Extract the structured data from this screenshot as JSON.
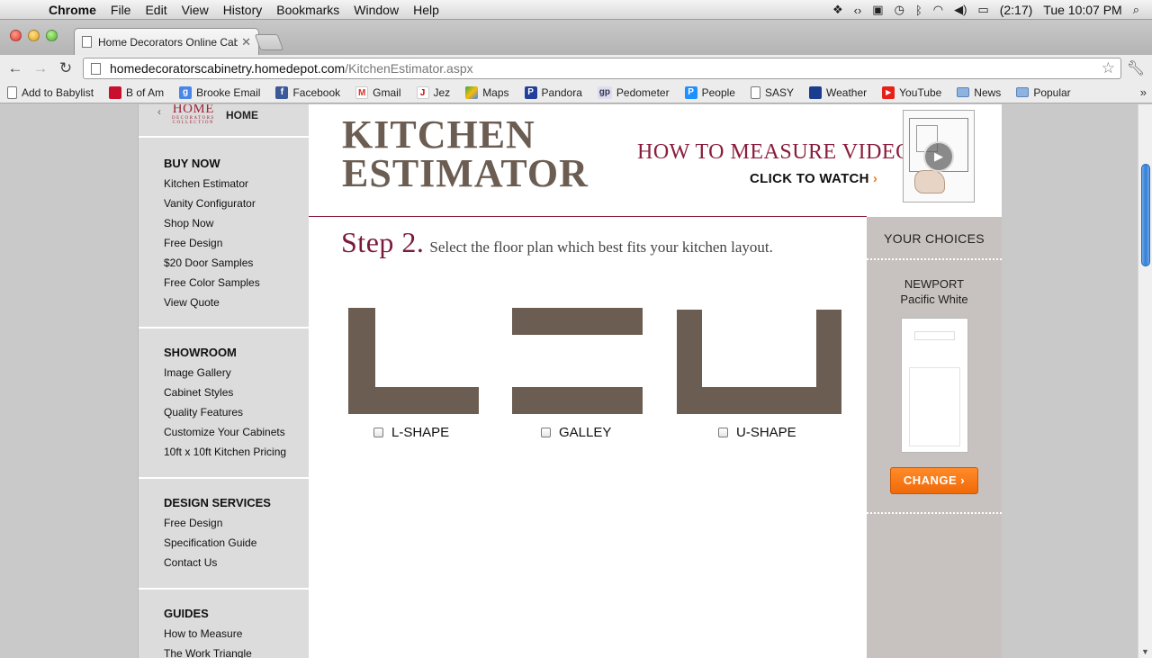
{
  "menubar": {
    "app": "Chrome",
    "menus": [
      "File",
      "Edit",
      "View",
      "History",
      "Bookmarks",
      "Window",
      "Help"
    ],
    "battery": "(2:17)",
    "clock": "Tue 10:07 PM"
  },
  "tab": {
    "title": "Home Decorators Online Cab"
  },
  "address": {
    "host": "homedecoratorscabinetry.homedepot.com",
    "path": "/KitchenEstimator.aspx"
  },
  "bookmarks": [
    {
      "label": "Add to Babylist",
      "icon": "doc"
    },
    {
      "label": "B of Am",
      "icon": "bofa"
    },
    {
      "label": "Brooke Email",
      "icon": "google"
    },
    {
      "label": "Facebook",
      "icon": "facebook"
    },
    {
      "label": "Gmail",
      "icon": "gmail"
    },
    {
      "label": "Jez",
      "icon": "jez"
    },
    {
      "label": "Maps",
      "icon": "maps"
    },
    {
      "label": "Pandora",
      "icon": "pandora"
    },
    {
      "label": "Pedometer",
      "icon": "gp"
    },
    {
      "label": "People",
      "icon": "people"
    },
    {
      "label": "SASY",
      "icon": "doc"
    },
    {
      "label": "Weather",
      "icon": "weather"
    },
    {
      "label": "YouTube",
      "icon": "youtube"
    },
    {
      "label": "News",
      "icon": "folder"
    },
    {
      "label": "Popular",
      "icon": "folder"
    }
  ],
  "brand": {
    "logo_line1": "HOME",
    "logo_line2": "DECORATORS",
    "logo_line3": "COLLECTION",
    "home": "HOME"
  },
  "nav": {
    "buy_now": {
      "title": "BUY NOW",
      "items": [
        "Kitchen Estimator",
        "Vanity Configurator",
        "Shop Now",
        "Free Design",
        "$20 Door Samples",
        "Free Color Samples",
        "View Quote"
      ]
    },
    "showroom": {
      "title": "SHOWROOM",
      "items": [
        "Image Gallery",
        "Cabinet Styles",
        "Quality Features",
        "Customize Your Cabinets",
        "10ft x 10ft Kitchen Pricing"
      ]
    },
    "design": {
      "title": "DESIGN SERVICES",
      "items": [
        "Free Design",
        "Specification Guide",
        "Contact Us"
      ]
    },
    "guides": {
      "title": "GUIDES",
      "items": [
        "How to Measure",
        "The Work Triangle"
      ]
    }
  },
  "header": {
    "title_line1": "KITCHEN",
    "title_line2": "ESTIMATOR",
    "video_title": "HOW TO MEASURE VIDEO",
    "video_cta": "CLICK TO WATCH",
    "video_cta_arrow": "›"
  },
  "step": {
    "number": "Step 2.",
    "instruction": "Select the floor plan which best fits your kitchen layout."
  },
  "plans": [
    {
      "label": "L-SHAPE",
      "checked": false
    },
    {
      "label": "GALLEY",
      "checked": false
    },
    {
      "label": "U-SHAPE",
      "checked": false
    }
  ],
  "choices": {
    "heading": "YOUR CHOICES",
    "door_style": "NEWPORT",
    "door_color": "Pacific White",
    "change_label": "CHANGE ›"
  },
  "colors": {
    "plan_fill": "#6b5d52",
    "accent_burgundy": "#8b1d3c",
    "change_orange": "#f47b1d"
  }
}
